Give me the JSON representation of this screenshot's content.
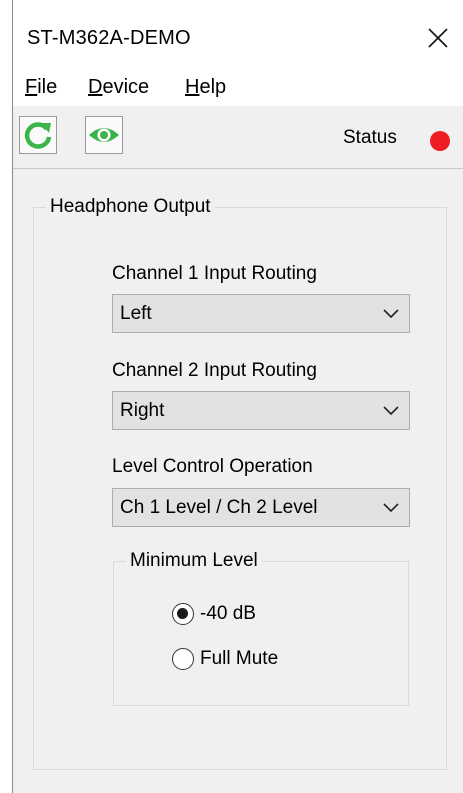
{
  "window": {
    "title": "ST-M362A-DEMO"
  },
  "menu": [
    {
      "accel": "F",
      "rest": "ile"
    },
    {
      "accel": "D",
      "rest": "evice"
    },
    {
      "accel": "H",
      "rest": "elp"
    }
  ],
  "toolbar": {
    "refresh_icon": "refresh-icon",
    "view_icon": "eye-icon",
    "status_label": "Status",
    "status_color": "#ee1c24"
  },
  "headphone_output": {
    "legend": "Headphone Output",
    "ch1_label": "Channel 1 Input Routing",
    "ch1_value": "Left",
    "ch2_label": "Channel 2 Input Routing",
    "ch2_value": "Right",
    "level_label": "Level Control Operation",
    "level_value": "Ch 1 Level / Ch 2 Level",
    "minimum_level": {
      "legend": "Minimum Level",
      "options": [
        {
          "label": "-40 dB",
          "selected": true
        },
        {
          "label": "Full Mute",
          "selected": false
        }
      ]
    }
  },
  "colors": {
    "accent_green": "#3bb44a",
    "status_red": "#ee1c24"
  }
}
